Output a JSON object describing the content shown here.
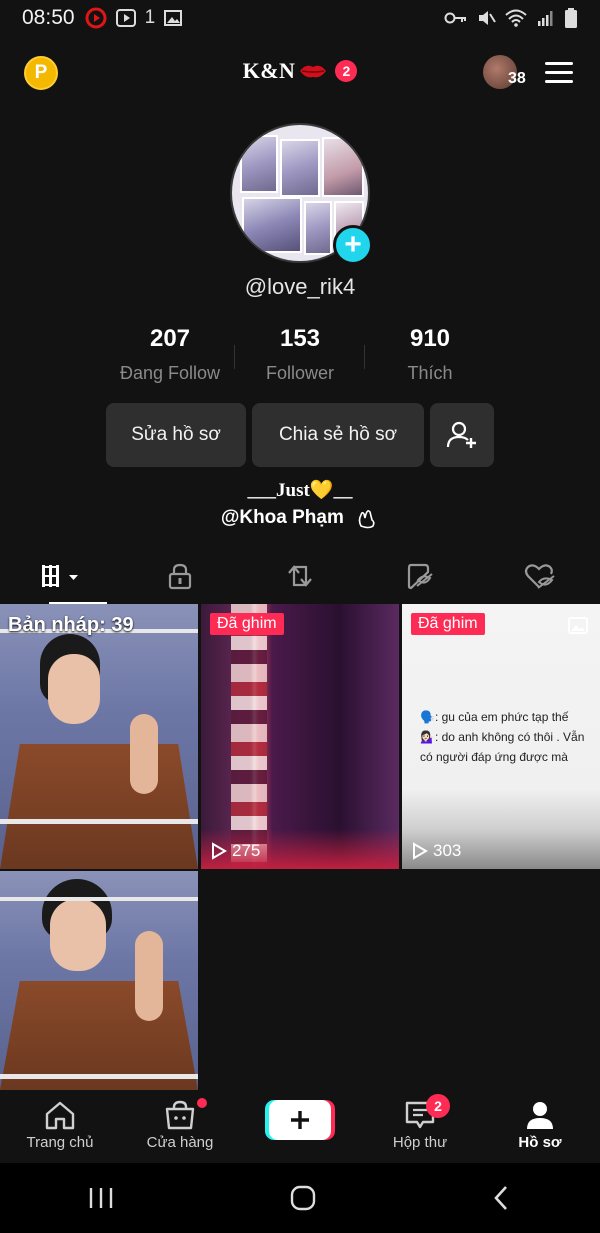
{
  "status_bar": {
    "time": "08:50",
    "notification_count": "1"
  },
  "header": {
    "title": "K&N",
    "notification_badge": "2",
    "avatar_count": "38",
    "points_icon_label": "P"
  },
  "profile": {
    "username": "@love_rik4",
    "stats": [
      {
        "value": "207",
        "label": "Đang Follow"
      },
      {
        "value": "153",
        "label": "Follower"
      },
      {
        "value": "910",
        "label": "Thích"
      }
    ],
    "edit_button": "Sửa hồ sơ",
    "share_button": "Chia sẻ hồ sơ",
    "bio_line1": "___Just💛__",
    "bio_line2": "@Khoa Phạm"
  },
  "grid": {
    "draft_label": "Bản nháp: 39",
    "pinned_label": "Đã ghim",
    "video2_views": "275",
    "video3_views": "303",
    "video3_text_line1": "🗣️: gu của em phức tạp thế",
    "video3_text_line2": "💁🏻‍♀️: do anh không có thôi . Vẫn có người đáp ứng được mà"
  },
  "bottom_nav": {
    "home": "Trang chủ",
    "shop": "Cửa hàng",
    "inbox": "Hộp thư",
    "inbox_badge": "2",
    "profile": "Hồ sơ"
  },
  "colors": {
    "background": "#121212",
    "accent_red": "#fe2c55",
    "accent_cyan": "#20d5ec",
    "button_bg": "#2f2f2f"
  }
}
